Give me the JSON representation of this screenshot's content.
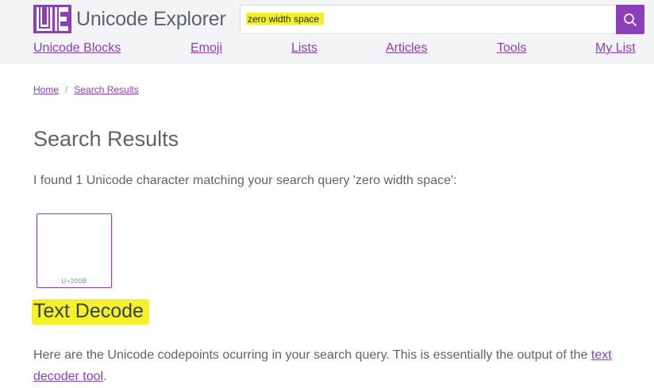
{
  "site": {
    "logo_mark": "UE",
    "logo_text": "Unicode Explorer"
  },
  "search": {
    "value": "zero width space",
    "placeholder": ""
  },
  "nav": {
    "items": [
      {
        "label": "Unicode Blocks"
      },
      {
        "label": "Emoji"
      },
      {
        "label": "Lists"
      },
      {
        "label": "Articles"
      },
      {
        "label": "Tools"
      },
      {
        "label": "My List"
      }
    ]
  },
  "breadcrumb": {
    "home": "Home",
    "separator": "/",
    "current": "Search Results"
  },
  "main": {
    "title": "Search Results",
    "result_text": "I found 1 Unicode character matching your search query 'zero width space':",
    "results": [
      {
        "codepoint": "U+200B"
      }
    ],
    "decode_title": "Text Decode",
    "decode_desc_before": "Here are the Unicode codepoints ocurring in your search query. This is essentially the output of the ",
    "decode_link": "text decoder tool",
    "decode_desc_after": "."
  },
  "colors": {
    "accent": "#8b3fb8",
    "highlight": "#f4f02a",
    "header_bg": "#f3f4f6",
    "text": "#5f6368"
  },
  "icons": {
    "search_button": "search-icon"
  }
}
